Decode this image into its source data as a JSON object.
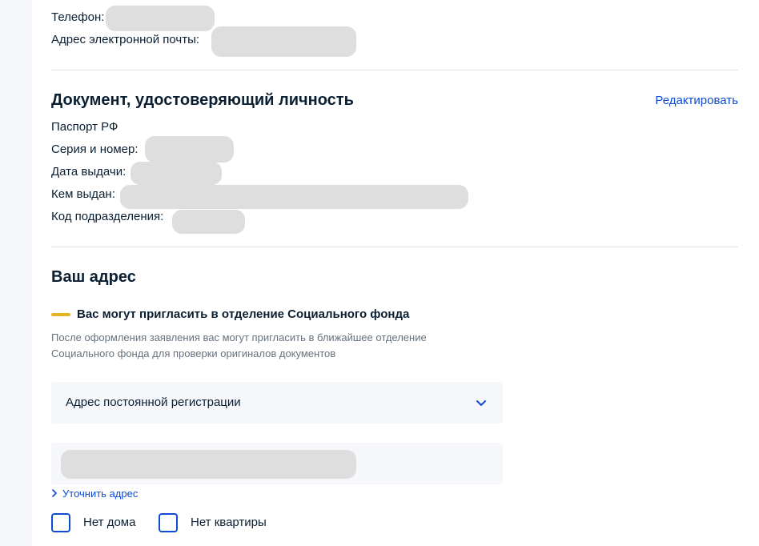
{
  "contacts": {
    "phone_label": "Телефон:",
    "email_label": "Адрес электронной почты:"
  },
  "identity_doc": {
    "title": "Документ, удостоверяющий личность",
    "edit_label": "Редактировать",
    "doc_type": "Паспорт РФ",
    "series_label": "Серия и номер:",
    "issue_date_label": "Дата выдачи:",
    "issued_by_label": "Кем выдан:",
    "unit_code_label": "Код подразделения:"
  },
  "address": {
    "title": "Ваш адрес",
    "notice_title": "Вас могут пригласить в отделение Социального фонда",
    "notice_text": "После оформления заявления вас могут пригласить в ближайшее отделение Социального фонда для проверки оригиналов документов",
    "select_value": "Адрес постоянной регистрации",
    "clarify_label": "Уточнить адрес",
    "no_house_label": "Нет дома",
    "no_apartment_label": "Нет квартиры"
  },
  "icons": {
    "select_chevron": "chevron-down-icon",
    "clarify_chevron": "chevron-right-icon"
  },
  "colors": {
    "accent": "#0d4cd3",
    "notice_bar": "#e8b21f",
    "text": "#0b1f33",
    "muted": "#66727f",
    "redaction": "#dedede"
  }
}
